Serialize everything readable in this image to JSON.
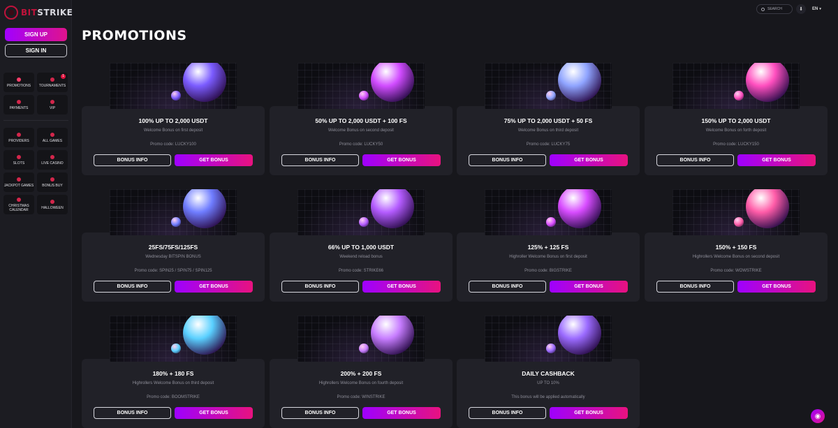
{
  "brand": {
    "bit": "BIT",
    "strike": "STRIKE"
  },
  "auth": {
    "sign_up": "SIGN UP",
    "sign_in": "SIGN IN"
  },
  "nav_top": [
    {
      "label": "PROMOTIONS",
      "icon": "promotions-icon"
    },
    {
      "label": "TOURNAMENTS",
      "icon": "trophy-icon",
      "badge": "1"
    },
    {
      "label": "PAYMENTS",
      "icon": "wallet-icon"
    },
    {
      "label": "VIP",
      "icon": "crown-icon"
    }
  ],
  "nav_games": [
    {
      "label": "PROVIDERS",
      "icon": "providers-icon"
    },
    {
      "label": "ALL GAMES",
      "icon": "grid-icon"
    },
    {
      "label": "SLOTS",
      "icon": "slots-icon"
    },
    {
      "label": "LIVE CASINO",
      "icon": "live-icon"
    },
    {
      "label": "JACKPOT GAMES",
      "icon": "jackpot-icon"
    },
    {
      "label": "BONUS BUY",
      "icon": "bonus-buy-icon"
    },
    {
      "label": "CHRISTMAS CALENDAR",
      "icon": "tree-icon"
    },
    {
      "label": "HALLOWEEN",
      "icon": "pumpkin-icon"
    }
  ],
  "topbar": {
    "search": "SEARCH",
    "lang": "EN"
  },
  "page": {
    "title": "PROMOTIONS"
  },
  "buttons": {
    "info": "BONUS INFO",
    "get": "GET BONUS"
  },
  "promos": [
    {
      "title": "100% UP TO 2,000 USDT",
      "subtitle": "Welcome Bonus on first deposit",
      "code": "Promo code: LUCKY100",
      "accent": "#7b5cff"
    },
    {
      "title": "50% UP TO 2,000 USDT + 100 FS",
      "subtitle": "Welcome Bonus on second deposit",
      "code": "Promo code: LUCKY50",
      "accent": "#d14cff"
    },
    {
      "title": "75% UP TO 2,000 USDT + 50 FS",
      "subtitle": "Welcome Bonus on third deposit",
      "code": "Promo code: LUCKY75",
      "accent": "#8fa4ff"
    },
    {
      "title": "150% UP TO 2,000 USDT",
      "subtitle": "Welcome Bonus on forth deposit",
      "code": "Promo code: LUCKY150",
      "accent": "#ff4fbf"
    },
    {
      "title": "25FS/75FS/125FS",
      "subtitle": "Wednesday BITSPIN BONUS",
      "code": "Promo code: SPIN25 / SPIN75 / SPIN125",
      "accent": "#6f7dff"
    },
    {
      "title": "66% UP TO 1,000 USDT",
      "subtitle": "Weekend reload bonus",
      "code": "Promo code: STRIKE66",
      "accent": "#b45cff"
    },
    {
      "title": "125% + 125 FS",
      "subtitle": "Highroller Welcome Bonus on first deposit",
      "code": "Promo code: BIGSTRIKE",
      "accent": "#d84cff"
    },
    {
      "title": "150% + 150 FS",
      "subtitle": "Highrollers Welcome Bonus on second deposit",
      "code": "Promo code: WOWSTRIKE",
      "accent": "#ff5ca8"
    },
    {
      "title": "180% + 180 FS",
      "subtitle": "Highrollers Welcome Bonus on third deposit",
      "code": "Promo code: BOOMSTRIKE",
      "accent": "#5ad0ff"
    },
    {
      "title": "200% + 200 FS",
      "subtitle": "Highrollers Welcome Bonus on fourth deposit",
      "code": "Promo code: WINSTRIKE",
      "accent": "#c77dff"
    },
    {
      "title": "DAILY CASHBACK",
      "subtitle": "UP TO 10%",
      "code": "This bonus will be applied automatically",
      "accent": "#9b6bff"
    }
  ]
}
